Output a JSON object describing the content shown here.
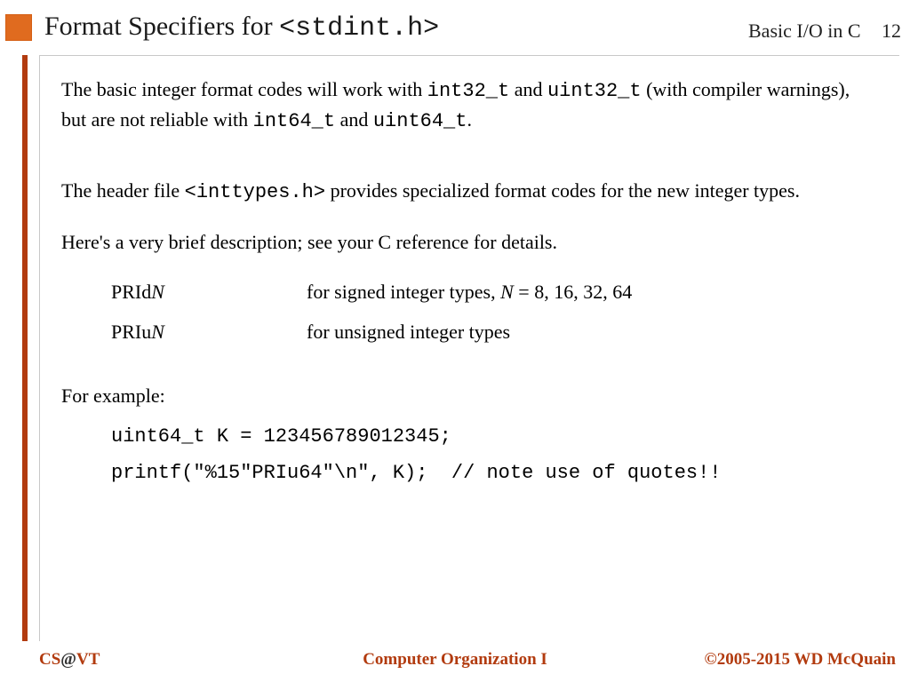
{
  "header": {
    "title_plain": "Format Specifiers for ",
    "title_code": "<stdint.h>",
    "topic": "Basic I/O in C",
    "page_number": "12"
  },
  "body": {
    "p1_a": "The basic integer format codes will work with ",
    "p1_c1": "int32_t",
    "p1_b": " and ",
    "p1_c2": "uint32_t",
    "p1_c": " (with compiler warnings), but are not reliable with ",
    "p1_c3": "int64_t",
    "p1_d": " and ",
    "p1_c4": "uint64_t",
    "p1_e": ".",
    "p2_a": "The header file ",
    "p2_code": "<inttypes.h>",
    "p2_b": " provides specialized format codes for the new integer types.",
    "p3": "Here's a very brief description; see your C reference for details.",
    "specs": [
      {
        "key_prefix": "PRId",
        "key_var": "N",
        "desc_a": "for signed integer types, ",
        "desc_var": "N",
        "desc_b": " = 8, 16, 32, 64"
      },
      {
        "key_prefix": "PRIu",
        "key_var": "N",
        "desc_a": "for unsigned integer types",
        "desc_var": "",
        "desc_b": ""
      }
    ],
    "p4": "For example:",
    "code_line1": "uint64_t K = 123456789012345;",
    "code_line2": "printf(\"%15\"PRIu64\"\\n\", K);  // note use of quotes!!"
  },
  "footer": {
    "left_cs": "CS",
    "left_at": "@",
    "left_vt": "VT",
    "center": "Computer Organization I",
    "right": "©2005-2015 WD McQuain"
  }
}
